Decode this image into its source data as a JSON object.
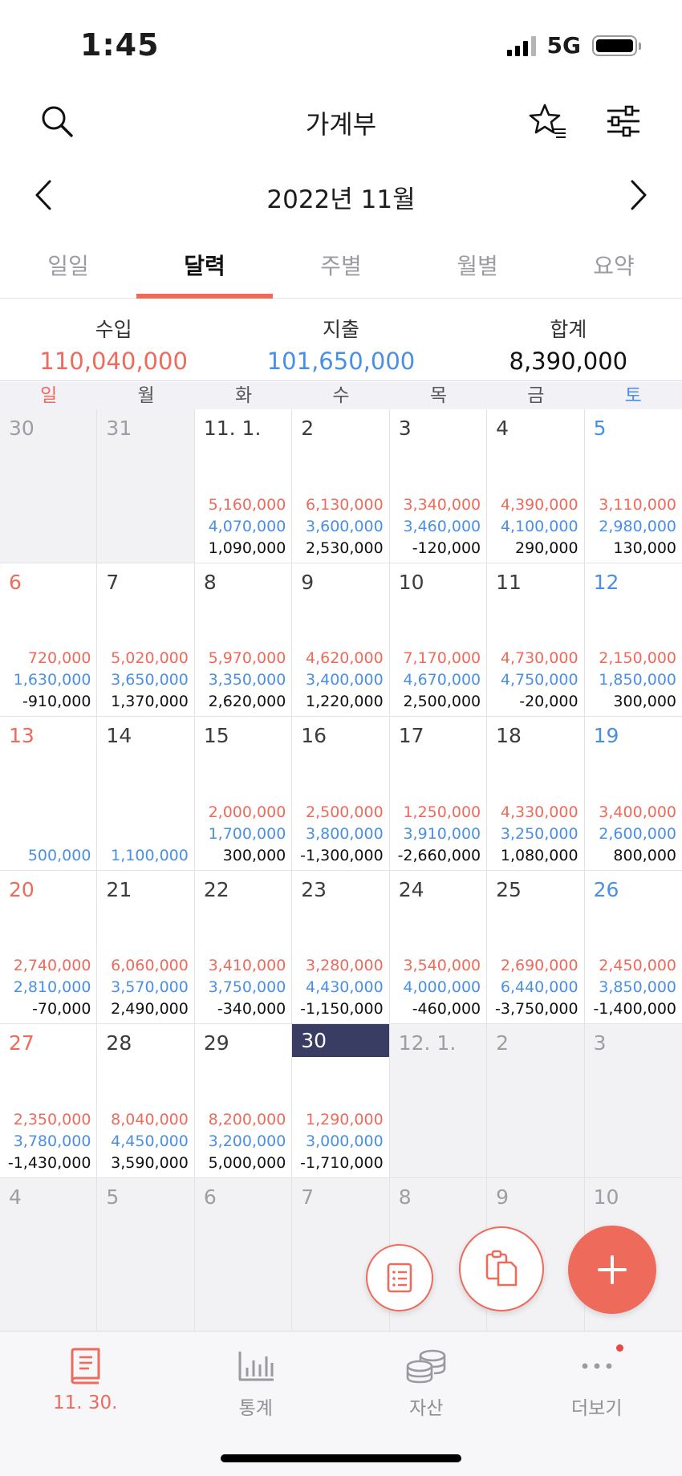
{
  "status": {
    "time": "1:45",
    "network": "5G"
  },
  "header": {
    "title": "가계부"
  },
  "month_nav": {
    "title": "2022년 11월"
  },
  "tabs": [
    {
      "label": "일일",
      "active": false
    },
    {
      "label": "달력",
      "active": true
    },
    {
      "label": "주별",
      "active": false
    },
    {
      "label": "월별",
      "active": false
    },
    {
      "label": "요약",
      "active": false
    }
  ],
  "summary": {
    "income_label": "수입",
    "income_value": "110,040,000",
    "expense_label": "지출",
    "expense_value": "101,650,000",
    "total_label": "합계",
    "total_value": "8,390,000"
  },
  "weekdays": [
    "일",
    "월",
    "화",
    "수",
    "목",
    "금",
    "토"
  ],
  "colors": {
    "accent": "#ee6a5a",
    "income": "#ee6a5a",
    "expense": "#4a8fe6",
    "today": "#3a3d63"
  },
  "calendar": [
    {
      "day": "30",
      "other": true
    },
    {
      "day": "31",
      "other": true
    },
    {
      "day": "11. 1.",
      "income": "5,160,000",
      "expense": "4,070,000",
      "total": "1,090,000"
    },
    {
      "day": "2",
      "income": "6,130,000",
      "expense": "3,600,000",
      "total": "2,530,000"
    },
    {
      "day": "3",
      "income": "3,340,000",
      "expense": "3,460,000",
      "total": "-120,000"
    },
    {
      "day": "4",
      "income": "4,390,000",
      "expense": "4,100,000",
      "total": "290,000"
    },
    {
      "day": "5",
      "income": "3,110,000",
      "expense": "2,980,000",
      "total": "130,000"
    },
    {
      "day": "6",
      "income": "720,000",
      "expense": "1,630,000",
      "total": "-910,000"
    },
    {
      "day": "7",
      "income": "5,020,000",
      "expense": "3,650,000",
      "total": "1,370,000"
    },
    {
      "day": "8",
      "income": "5,970,000",
      "expense": "3,350,000",
      "total": "2,620,000"
    },
    {
      "day": "9",
      "income": "4,620,000",
      "expense": "3,400,000",
      "total": "1,220,000"
    },
    {
      "day": "10",
      "income": "7,170,000",
      "expense": "4,670,000",
      "total": "2,500,000"
    },
    {
      "day": "11",
      "income": "4,730,000",
      "expense": "4,750,000",
      "total": "-20,000"
    },
    {
      "day": "12",
      "income": "2,150,000",
      "expense": "1,850,000",
      "total": "300,000"
    },
    {
      "day": "13",
      "expense": "500,000"
    },
    {
      "day": "14",
      "expense": "1,100,000"
    },
    {
      "day": "15",
      "income": "2,000,000",
      "expense": "1,700,000",
      "total": "300,000"
    },
    {
      "day": "16",
      "income": "2,500,000",
      "expense": "3,800,000",
      "total": "-1,300,000"
    },
    {
      "day": "17",
      "income": "1,250,000",
      "expense": "3,910,000",
      "total": "-2,660,000"
    },
    {
      "day": "18",
      "income": "4,330,000",
      "expense": "3,250,000",
      "total": "1,080,000"
    },
    {
      "day": "19",
      "income": "3,400,000",
      "expense": "2,600,000",
      "total": "800,000"
    },
    {
      "day": "20",
      "income": "2,740,000",
      "expense": "2,810,000",
      "total": "-70,000"
    },
    {
      "day": "21",
      "income": "6,060,000",
      "expense": "3,570,000",
      "total": "2,490,000"
    },
    {
      "day": "22",
      "income": "3,410,000",
      "expense": "3,750,000",
      "total": "-340,000"
    },
    {
      "day": "23",
      "income": "3,280,000",
      "expense": "4,430,000",
      "total": "-1,150,000"
    },
    {
      "day": "24",
      "income": "3,540,000",
      "expense": "4,000,000",
      "total": "-460,000"
    },
    {
      "day": "25",
      "income": "2,690,000",
      "expense": "6,440,000",
      "total": "-3,750,000"
    },
    {
      "day": "26",
      "income": "2,450,000",
      "expense": "3,850,000",
      "total": "-1,400,000"
    },
    {
      "day": "27",
      "income": "2,350,000",
      "expense": "3,780,000",
      "total": "-1,430,000"
    },
    {
      "day": "28",
      "income": "8,040,000",
      "expense": "4,450,000",
      "total": "3,590,000"
    },
    {
      "day": "29",
      "income": "8,200,000",
      "expense": "3,200,000",
      "total": "5,000,000"
    },
    {
      "day": "30",
      "income": "1,290,000",
      "expense": "3,000,000",
      "total": "-1,710,000",
      "today": true
    },
    {
      "day": "12. 1.",
      "other": true
    },
    {
      "day": "2",
      "other": true
    },
    {
      "day": "3",
      "other": true
    },
    {
      "day": "4",
      "other": true
    },
    {
      "day": "5",
      "other": true
    },
    {
      "day": "6",
      "other": true
    },
    {
      "day": "7",
      "other": true
    },
    {
      "day": "8",
      "other": true
    },
    {
      "day": "9",
      "other": true
    },
    {
      "day": "10",
      "other": true
    }
  ],
  "bottom_nav": [
    {
      "label": "11. 30.",
      "icon": "ledger-book-icon",
      "active": true
    },
    {
      "label": "통계",
      "icon": "bar-chart-icon",
      "active": false
    },
    {
      "label": "자산",
      "icon": "coins-stack-icon",
      "active": false
    },
    {
      "label": "더보기",
      "icon": "more-dots-icon",
      "active": false
    }
  ]
}
